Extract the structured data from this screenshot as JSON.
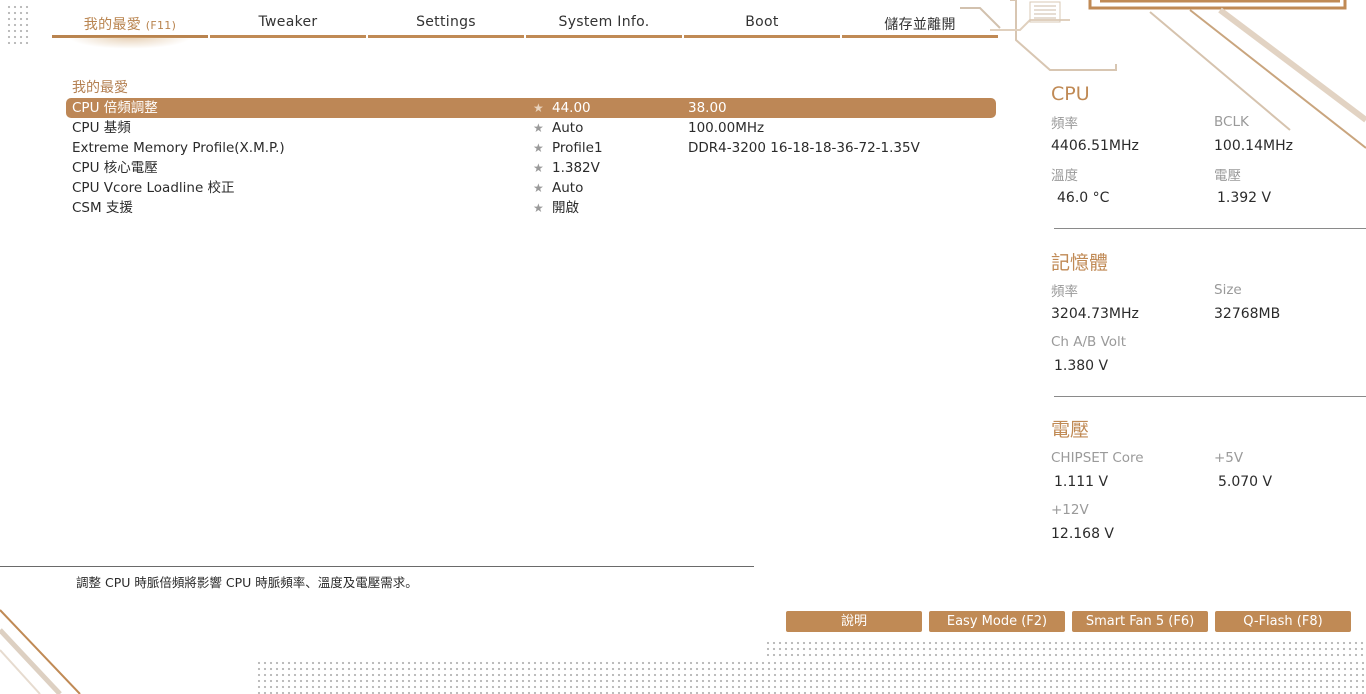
{
  "tabs": [
    {
      "label": "我的最愛",
      "key": "(F11)"
    },
    {
      "label": "Tweaker"
    },
    {
      "label": "Settings"
    },
    {
      "label": "System Info."
    },
    {
      "label": "Boot"
    },
    {
      "label": "儲存並離開"
    }
  ],
  "main": {
    "section_title": "我的最愛",
    "items": [
      {
        "label": "CPU 倍頻調整",
        "value": "44.00",
        "current": "38.00"
      },
      {
        "label": "CPU 基頻",
        "value": "Auto",
        "current": "100.00MHz"
      },
      {
        "label": "Extreme Memory Profile(X.M.P.)",
        "value": "Profile1",
        "current": "DDR4-3200 16-18-18-36-72-1.35V"
      },
      {
        "label": "CPU 核心電壓",
        "value": "1.382V",
        "current": ""
      },
      {
        "label": "CPU Vcore Loadline 校正",
        "value": "Auto",
        "current": ""
      },
      {
        "label": "CSM 支援",
        "value": "開啟",
        "current": ""
      }
    ],
    "star_glyph": "★"
  },
  "help": {
    "text": "調整 CPU 時脈倍頻將影響 CPU 時脈頻率、溫度及電壓需求。"
  },
  "panel": {
    "cpu": {
      "title": "CPU",
      "freq_label": "頻率",
      "freq": "4406.51MHz",
      "bclk_label": "BCLK",
      "bclk": "100.14MHz",
      "temp_label": "溫度",
      "temp": "46.0 °C",
      "volt_label": "電壓",
      "volt": "1.392 V"
    },
    "memory": {
      "title": "記憶體",
      "freq_label": "頻率",
      "freq": "3204.73MHz",
      "size_label": "Size",
      "size": "32768MB",
      "chvolt_label": "Ch A/B Volt",
      "chvolt": "1.380 V"
    },
    "voltage": {
      "title": "電壓",
      "chipset_label": "CHIPSET Core",
      "chipset": "1.111 V",
      "p5v_label": "+5V",
      "p5v": "5.070 V",
      "p12v_label": "+12V",
      "p12v": "12.168 V"
    }
  },
  "buttons": {
    "help": "說明",
    "easy_mode": "Easy Mode (F2)",
    "smart_fan": "Smart Fan 5 (F6)",
    "qflash": "Q-Flash (F8)"
  },
  "colors": {
    "accent": "#c08a55",
    "selected_row": "#bd8756"
  }
}
